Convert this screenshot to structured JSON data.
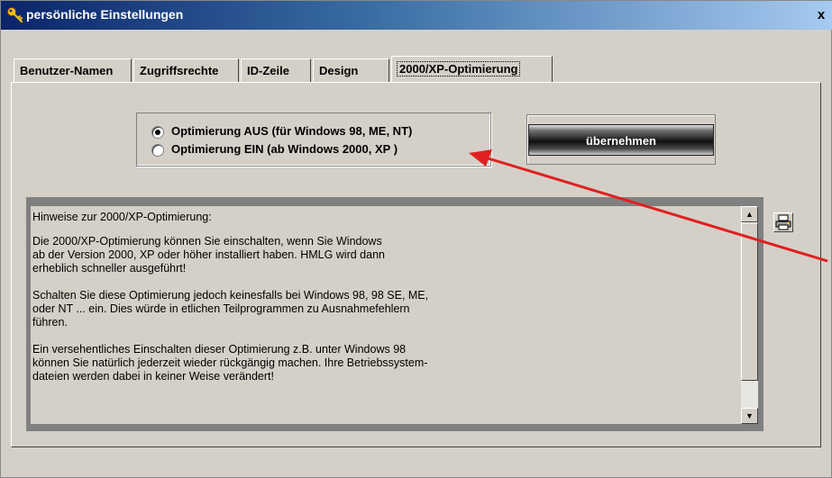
{
  "window": {
    "title": "persönliche Einstellungen",
    "close_label": "x"
  },
  "tabs": [
    {
      "label": "Benutzer-Namen",
      "active": false
    },
    {
      "label": "Zugriffsrechte",
      "active": false
    },
    {
      "label": "ID-Zeile",
      "active": false
    },
    {
      "label": "Design",
      "active": false
    },
    {
      "label": "2000/XP-Optimierung",
      "active": true
    }
  ],
  "optimization": {
    "options": [
      {
        "label": "Optimierung AUS (für Windows 98, ME, NT)",
        "selected": true
      },
      {
        "label": "Optimierung EIN (ab Windows 2000, XP )",
        "selected": false
      }
    ],
    "apply_label": "übernehmen"
  },
  "info": {
    "paragraphs": [
      "Hinweise zur 2000/XP-Optimierung:",
      "Die 2000/XP-Optimierung können Sie einschalten, wenn Sie Windows\nab der Version 2000, XP oder höher installiert haben. HMLG wird dann\nerheblich schneller ausgeführt!",
      "Schalten Sie diese Optimierung jedoch keinesfalls bei Windows 98, 98 SE, ME,\noder NT ... ein. Dies würde in etlichen Teilprogrammen zu Ausnahmefehlern\nführen.",
      "Ein versehentliches Einschalten dieser Optimierung z.B. unter Windows 98\nkönnen Sie natürlich jederzeit wieder rückgängig machen. Ihre Betriebssystem-\ndateien werden dabei in keiner Weise verändert!"
    ]
  },
  "icons": {
    "title": "key-icon",
    "print": "printer-icon",
    "scroll_up": "scroll-up-arrow-icon",
    "scroll_down": "scroll-down-arrow-icon"
  },
  "colors": {
    "annotation_arrow": "#e02020",
    "titlebar_start": "#0a246a",
    "titlebar_end": "#a6caf0"
  }
}
